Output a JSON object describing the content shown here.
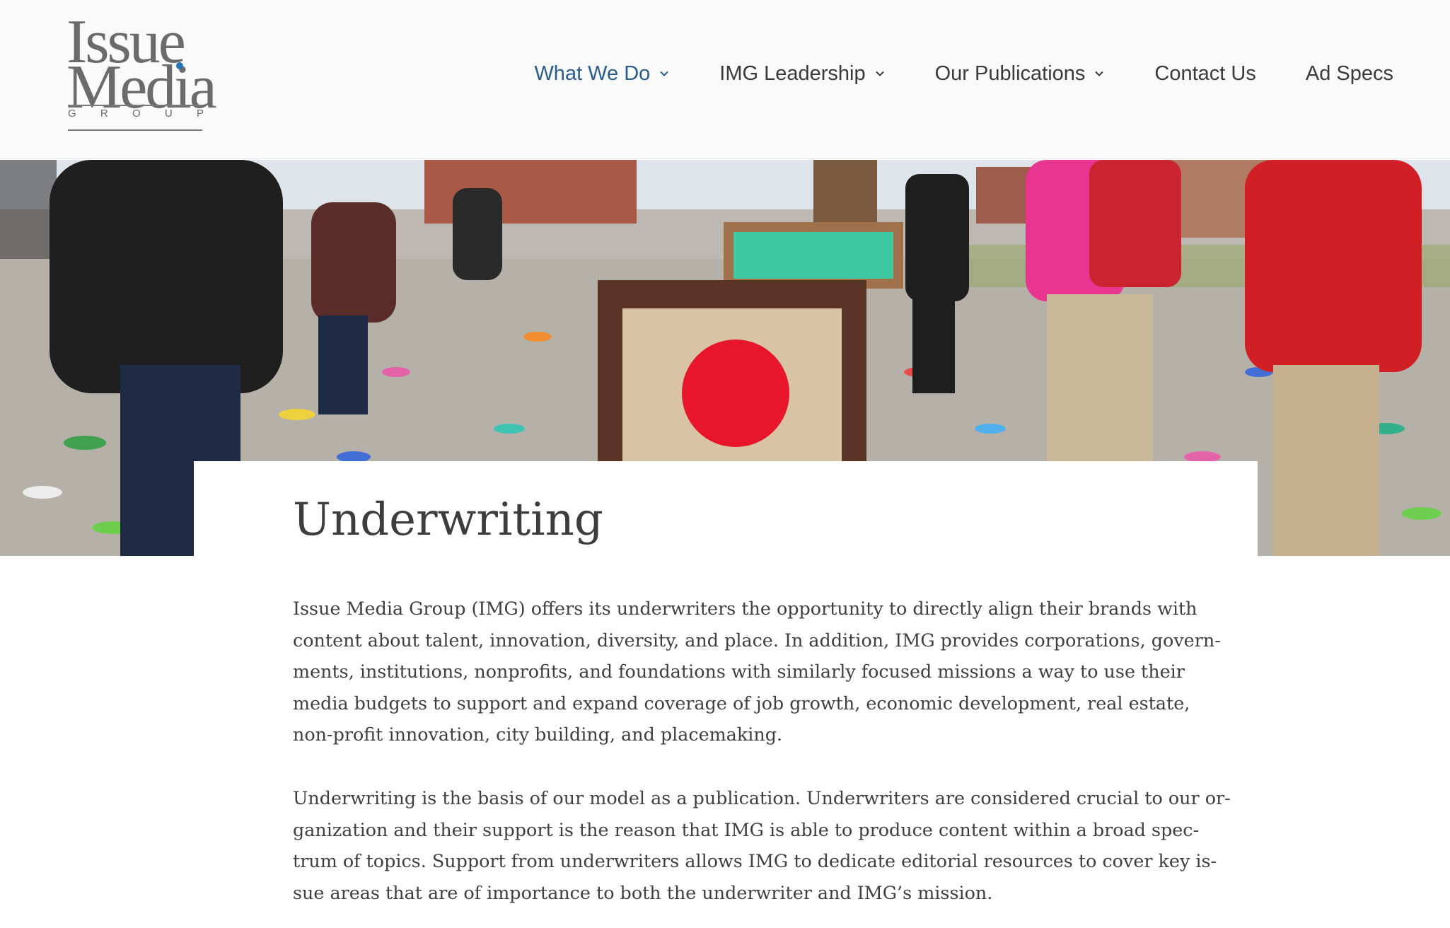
{
  "logo": {
    "line1": "Issue",
    "line2": "Media",
    "group_letters": [
      "G",
      "R",
      "O",
      "U",
      "P"
    ]
  },
  "nav": {
    "items": [
      {
        "label": "What We Do",
        "has_dropdown": true,
        "active": true
      },
      {
        "label": "IMG Leadership",
        "has_dropdown": true,
        "active": false
      },
      {
        "label": "Our Publications",
        "has_dropdown": true,
        "active": false
      },
      {
        "label": "Contact Us",
        "has_dropdown": false,
        "active": false
      },
      {
        "label": "Ad Specs",
        "has_dropdown": false,
        "active": false
      }
    ]
  },
  "hero": {
    "icon": "photo-street-shoes-kids"
  },
  "page": {
    "title": "Underwriting",
    "paragraph1_lines": [
      "Issue Media Group (IMG) offers its underwriters the opportunity to directly align their brands with",
      "content about talent, innovation, diversity, and place. In addition, IMG provides corporations, govern-",
      "ments, institutions, nonprofits, and foundations with similarly focused missions a way to use their",
      "media budgets to support and expand coverage of job growth, economic development, real estate,",
      "non-profit innovation, city building, and placemaking."
    ],
    "paragraph2_lines": [
      "Underwriting is the basis of our model as a publication. Underwriters are considered crucial to our or-",
      "ganization and their support is the reason that IMG is able to produce content within a broad spec-",
      "trum of topics. Support from underwriters allows IMG to dedicate editorial resources to cover key is-",
      "sue areas that are of importance to both the underwriter and IMG’s mission."
    ]
  },
  "colors": {
    "nav_active": "#2a5d8f",
    "nav_text": "#3a3a3a",
    "body_text": "#3f3f3f",
    "logo_gray": "#6b6b6b",
    "logo_dot": "#2a73b8"
  }
}
